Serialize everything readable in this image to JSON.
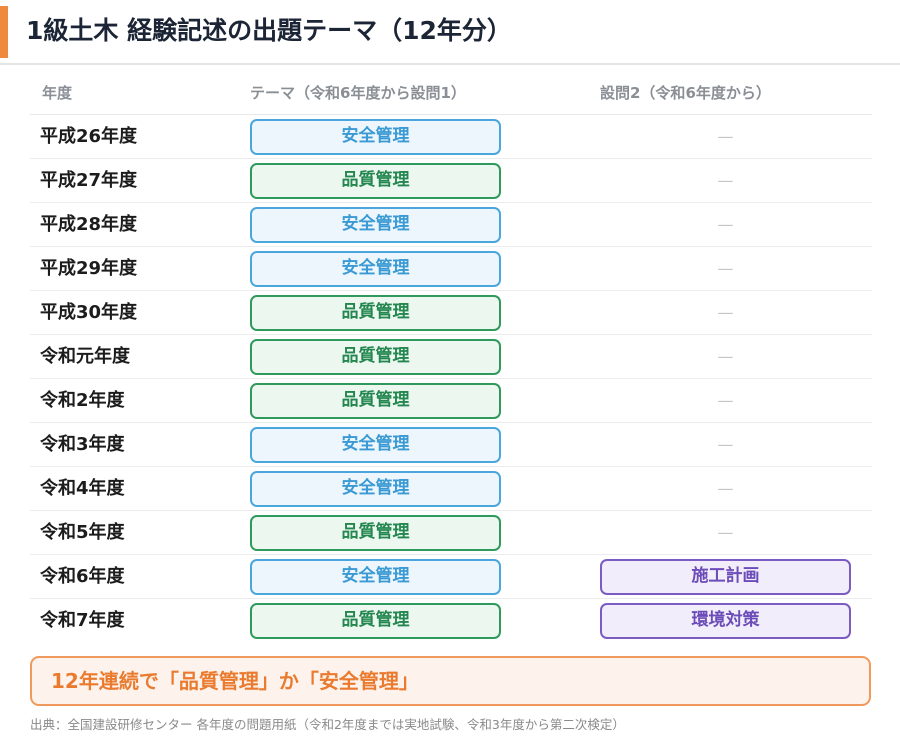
{
  "header": {
    "title": "1級土木 経験記述の出題テーマ（12年分）",
    "accent_color": "#ef8a3c"
  },
  "table": {
    "columns": [
      "年度",
      "テーマ（令和6年度から設問1）",
      "設問2（令和6年度から）"
    ],
    "rows": [
      {
        "year": "平成26年度",
        "theme": "安全管理",
        "theme_type": "safety",
        "q2": "—",
        "q2_type": "none"
      },
      {
        "year": "平成27年度",
        "theme": "品質管理",
        "theme_type": "quality",
        "q2": "—",
        "q2_type": "none"
      },
      {
        "year": "平成28年度",
        "theme": "安全管理",
        "theme_type": "safety",
        "q2": "—",
        "q2_type": "none"
      },
      {
        "year": "平成29年度",
        "theme": "安全管理",
        "theme_type": "safety",
        "q2": "—",
        "q2_type": "none"
      },
      {
        "year": "平成30年度",
        "theme": "品質管理",
        "theme_type": "quality",
        "q2": "—",
        "q2_type": "none"
      },
      {
        "year": "令和元年度",
        "theme": "品質管理",
        "theme_type": "quality",
        "q2": "—",
        "q2_type": "none"
      },
      {
        "year": "令和2年度",
        "theme": "品質管理",
        "theme_type": "quality",
        "q2": "—",
        "q2_type": "none"
      },
      {
        "year": "令和3年度",
        "theme": "安全管理",
        "theme_type": "safety",
        "q2": "—",
        "q2_type": "none"
      },
      {
        "year": "令和4年度",
        "theme": "安全管理",
        "theme_type": "safety",
        "q2": "—",
        "q2_type": "none"
      },
      {
        "year": "令和5年度",
        "theme": "品質管理",
        "theme_type": "quality",
        "q2": "—",
        "q2_type": "none"
      },
      {
        "year": "令和6年度",
        "theme": "安全管理",
        "theme_type": "safety",
        "q2": "施工計画",
        "q2_type": "plan"
      },
      {
        "year": "令和7年度",
        "theme": "品質管理",
        "theme_type": "quality",
        "q2": "環境対策",
        "q2_type": "plan"
      }
    ]
  },
  "colors": {
    "safety": "#4aa6dc",
    "quality": "#2f9a5c",
    "plan": "#7b5cc4",
    "callout": "#ef9a5c"
  },
  "callout": {
    "text": "12年連続で「品質管理」か「安全管理」"
  },
  "source": {
    "text": "出典：全国建設研修センター 各年度の問題用紙（令和2年度までは実地試験、令和3年度から第二次検定）"
  }
}
